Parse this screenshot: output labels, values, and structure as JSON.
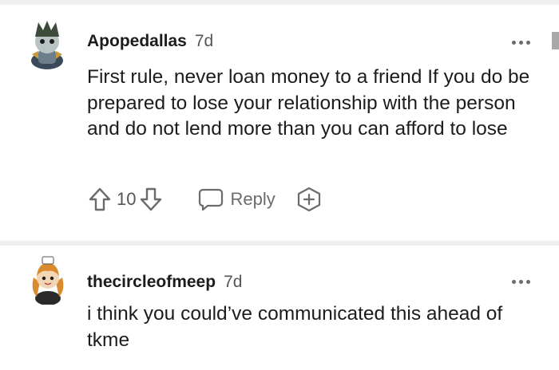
{
  "comments": [
    {
      "username": "Apopedallas",
      "timestamp": "7d",
      "body": "First rule, never loan money to a friend If you do be prepared to lose your relationship with the person and do not lend more than you can afford to lose",
      "vote_count": "10",
      "reply_label": "Reply",
      "avatar_icon": "snoo-avatar-icon"
    },
    {
      "username": "thecircleofmeep",
      "timestamp": "7d",
      "body": "i think you could’ve communicated this ahead of tkme",
      "avatar_icon": "snoo-avatar-icon"
    }
  ],
  "colors": {
    "divider": "#edeff1",
    "text": "#1c1c1c",
    "muted": "#555555"
  }
}
